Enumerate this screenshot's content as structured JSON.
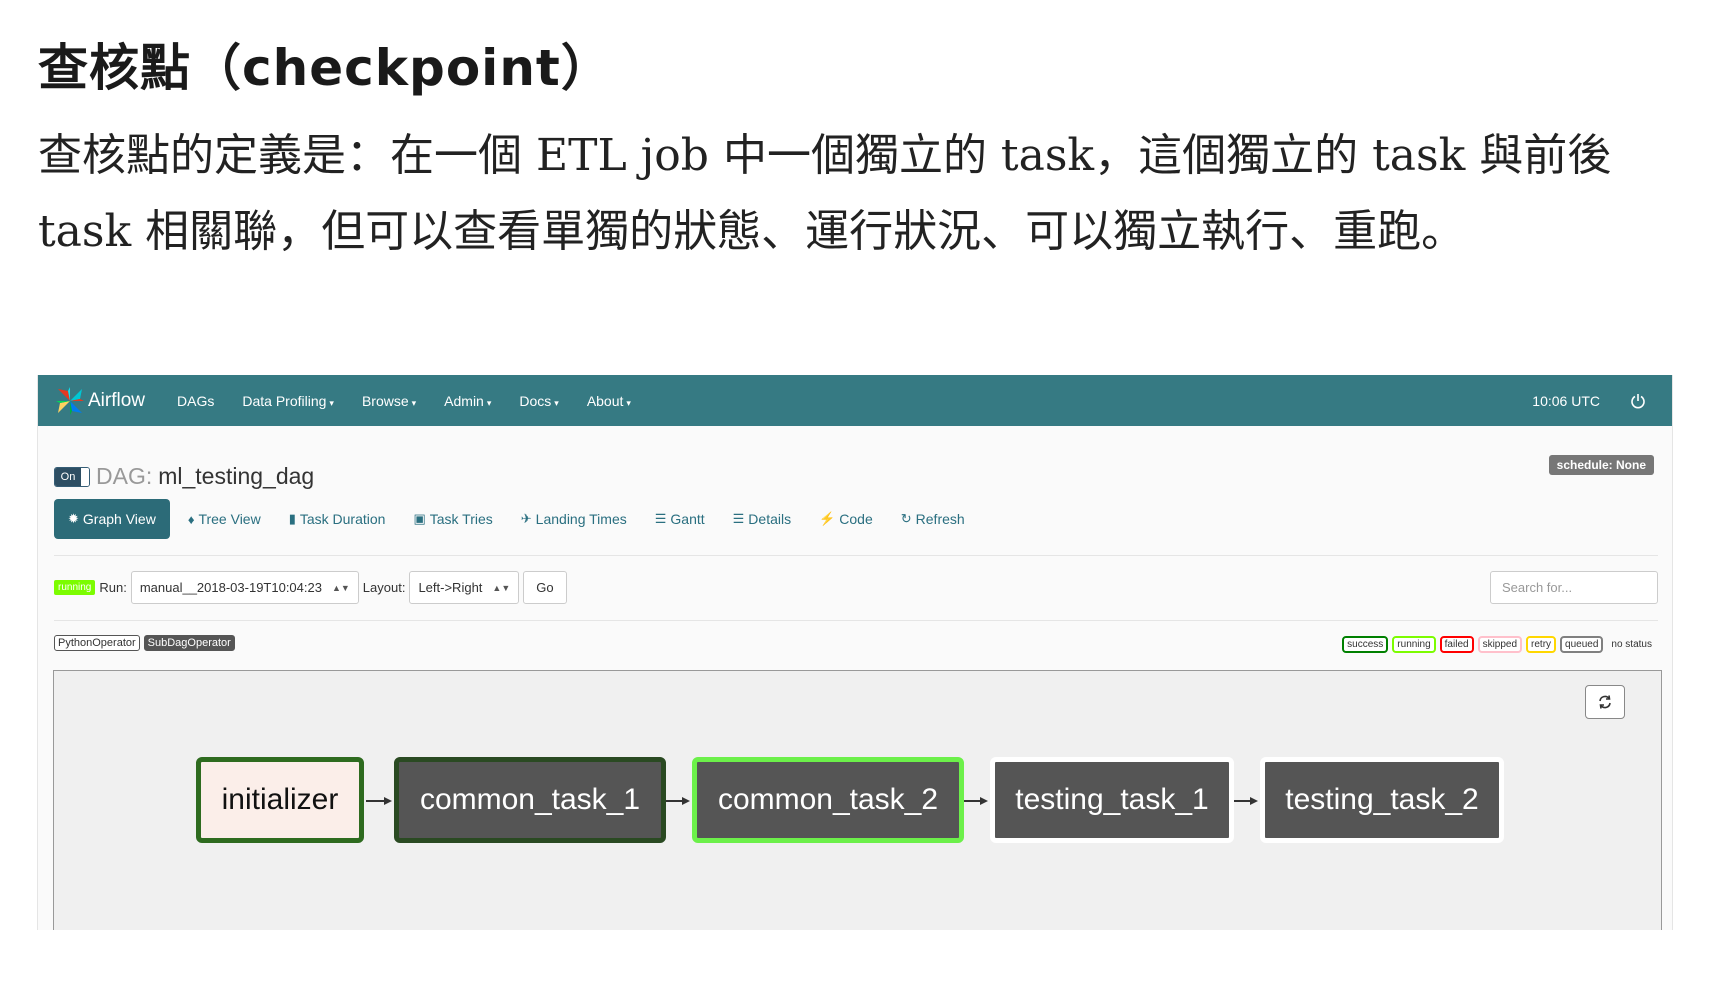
{
  "article": {
    "title": "查核點（checkpoint）",
    "paragraph": "查核點的定義是：在一個 ETL job 中一個獨立的 task，這個獨立的 task 與前後 task 相關聯，但可以查看單獨的狀態、運行狀況、可以獨立執行、重跑。"
  },
  "navbar": {
    "brand": "Airflow",
    "items": [
      "DAGs",
      "Data Profiling",
      "Browse",
      "Admin",
      "Docs",
      "About"
    ],
    "caret": "▾",
    "time": "10:06 UTC",
    "logo_icon": "pinwheel-icon",
    "power_icon": "power-icon"
  },
  "dag": {
    "toggle": "On",
    "label": "DAG:",
    "name": "ml_testing_dag",
    "schedule": "schedule: None"
  },
  "tabs": [
    {
      "icon": "✹",
      "label": "Graph View"
    },
    {
      "icon": "♦",
      "label": "Tree View"
    },
    {
      "icon": "▮",
      "label": "Task Duration"
    },
    {
      "icon": "▣",
      "label": "Task Tries"
    },
    {
      "icon": "✈",
      "label": "Landing Times"
    },
    {
      "icon": "☰",
      "label": "Gantt"
    },
    {
      "icon": "☰",
      "label": "Details"
    },
    {
      "icon": "⚡",
      "label": "Code"
    },
    {
      "icon": "↻",
      "label": "Refresh"
    }
  ],
  "runbar": {
    "state": "running",
    "run_label": "Run:",
    "run_value": "manual__2018-03-19T10:04:23",
    "layout_label": "Layout:",
    "layout_value": "Left->Right",
    "go": "Go",
    "search_placeholder": "Search for..."
  },
  "operators": [
    "PythonOperator",
    "SubDagOperator"
  ],
  "states": [
    {
      "label": "success",
      "color": "#008000"
    },
    {
      "label": "running",
      "color": "#7cfc00"
    },
    {
      "label": "failed",
      "color": "#ff0000"
    },
    {
      "label": "skipped",
      "color": "#ffc0cb"
    },
    {
      "label": "retry",
      "color": "#ffd700"
    },
    {
      "label": "queued",
      "color": "#808080"
    }
  ],
  "no_status": "no status",
  "tasks": [
    "initializer",
    "common_task_1",
    "common_task_2",
    "testing_task_1",
    "testing_task_2"
  ],
  "colors": {
    "navbar": "#367a83",
    "accent": "#2c6b78",
    "node_fill": "#555555"
  }
}
